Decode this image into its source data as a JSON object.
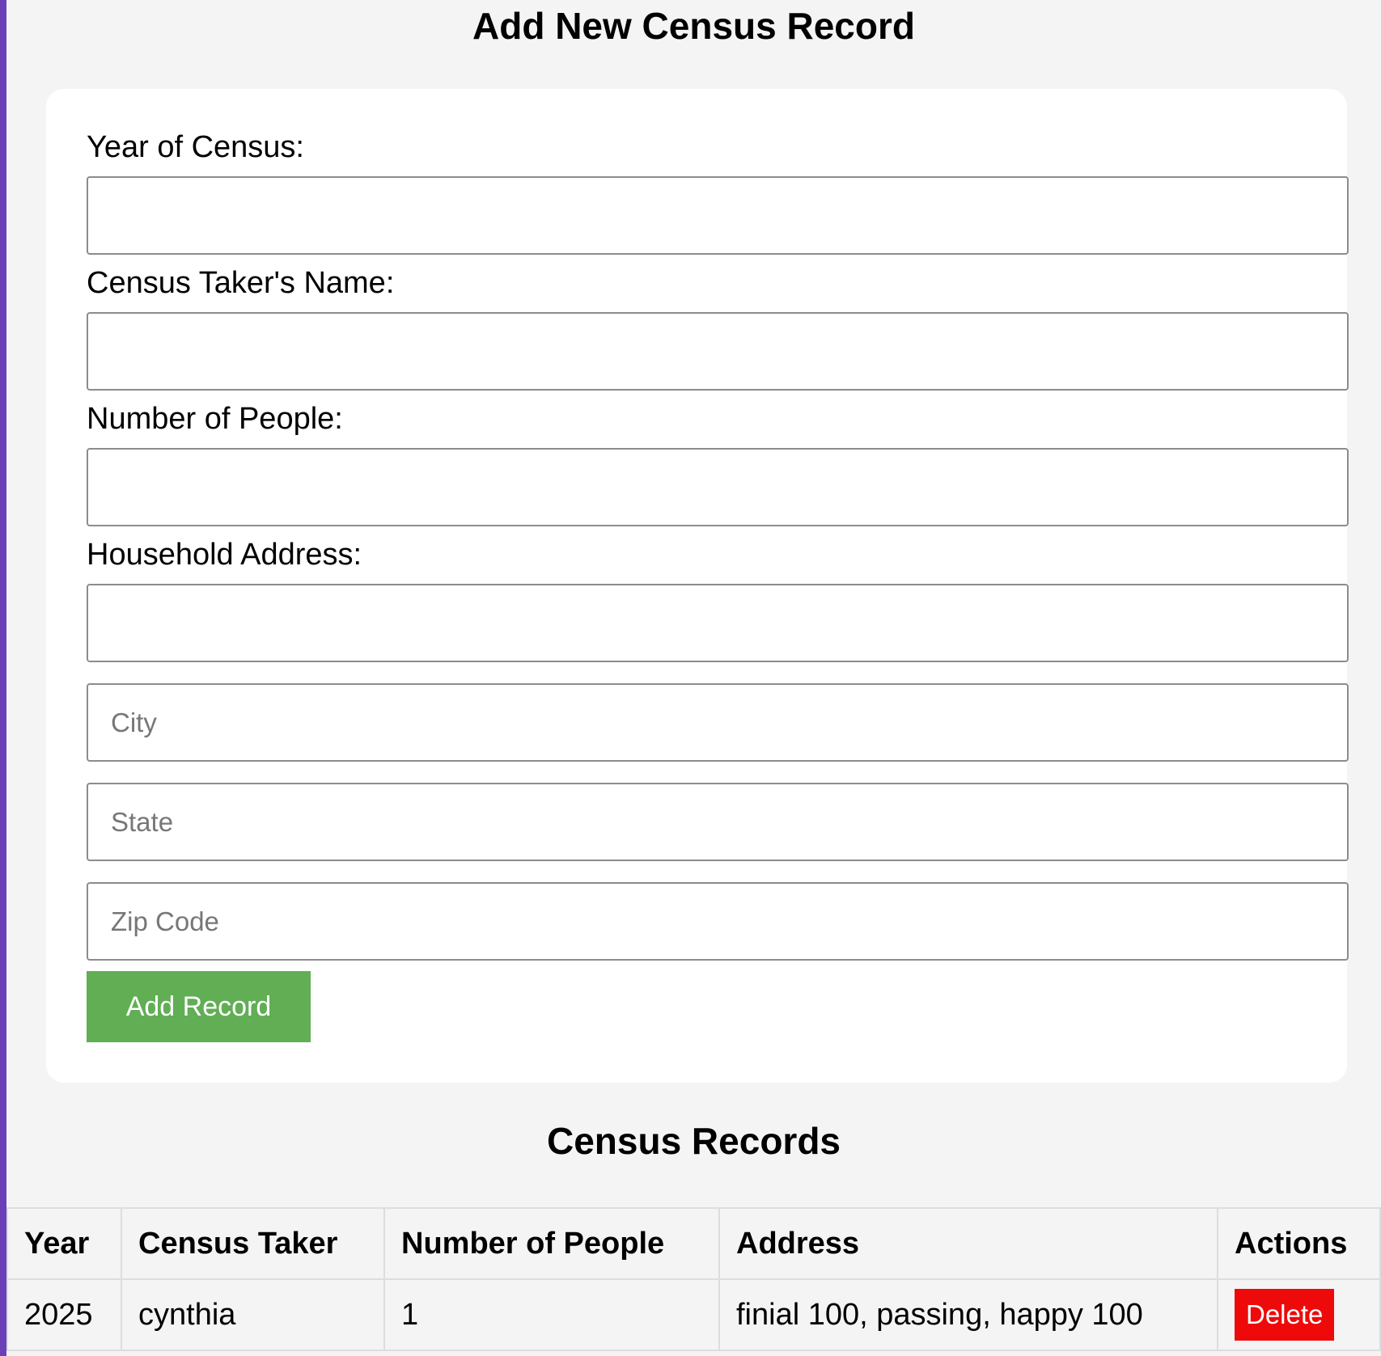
{
  "form": {
    "title": "Add New Census Record",
    "year_label": "Year of Census:",
    "year_value": "",
    "taker_label": "Census Taker's Name:",
    "taker_value": "",
    "people_label": "Number of People:",
    "people_value": "",
    "address_label": "Household Address:",
    "address_value": "",
    "city_placeholder": "City",
    "state_placeholder": "State",
    "zip_placeholder": "Zip Code",
    "submit_label": "Add Record"
  },
  "records": {
    "title": "Census Records",
    "columns": [
      "Year",
      "Census Taker",
      "Number of People",
      "Address",
      "Actions"
    ],
    "rows": [
      {
        "year": "2025",
        "taker": "cynthia",
        "people": "1",
        "address": "finial 100, passing, happy 100",
        "action_label": "Delete"
      }
    ]
  },
  "colors": {
    "accent_bar": "#6a40b8",
    "add_button": "#61ae55",
    "delete_button": "#ee0a0a"
  }
}
